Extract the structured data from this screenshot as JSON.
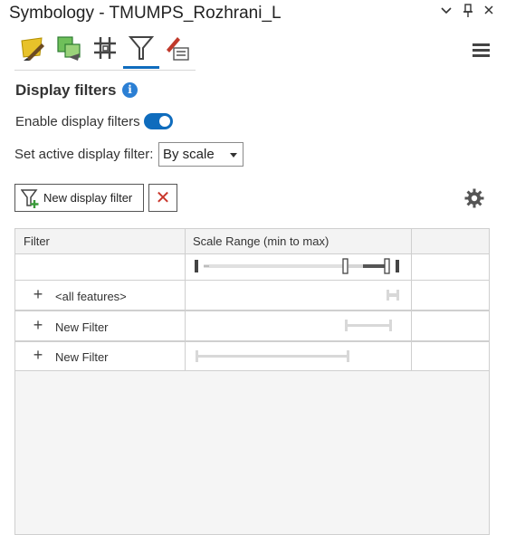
{
  "window": {
    "title": "Symbology - TMUMPS_Rozhrani_L",
    "chevron_icon": "chevron-down-icon",
    "pin_icon": "pin-icon",
    "close_icon": "close-icon"
  },
  "tabs": [
    {
      "name": "primary-symbology",
      "icon": "paintbrush-polygon-icon",
      "active": false
    },
    {
      "name": "vary-symbology",
      "icon": "layered-squares-icon",
      "active": false
    },
    {
      "name": "symbol-layer-drawing",
      "icon": "hash-grid-icon",
      "active": false
    },
    {
      "name": "display-filters",
      "icon": "funnel-icon",
      "active": true
    },
    {
      "name": "symbology-options",
      "icon": "brush-list-icon",
      "active": false
    }
  ],
  "section": {
    "title": "Display filters",
    "info_icon": "i"
  },
  "enable": {
    "label": "Enable display filters",
    "enabled": true
  },
  "active_filter": {
    "label": "Set active display filter:",
    "value": "By scale"
  },
  "toolbar": {
    "new_label": "New display filter",
    "delete_icon": "✕"
  },
  "grid": {
    "columns": [
      "Filter",
      "Scale Range (min to max)"
    ],
    "rows": [
      {
        "label": "<all features>"
      },
      {
        "label": "New Filter"
      },
      {
        "label": "New Filter"
      }
    ]
  },
  "colors": {
    "accent": "#0f6cbd",
    "delete": "#c9362b"
  }
}
